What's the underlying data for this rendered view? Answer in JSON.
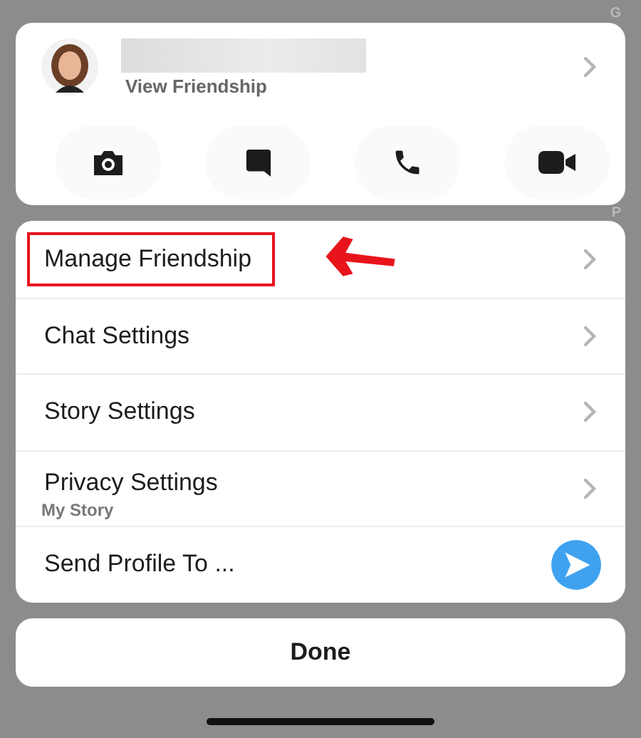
{
  "side_index": [
    "G",
    "P"
  ],
  "profile": {
    "subtitle": "View Friendship",
    "name_redacted": true
  },
  "actions": [
    {
      "kind": "camera"
    },
    {
      "kind": "chat"
    },
    {
      "kind": "call"
    },
    {
      "kind": "video"
    }
  ],
  "menu": [
    {
      "label": "Manage Friendship",
      "kind": "chevron",
      "highlighted": true
    },
    {
      "label": "Chat Settings",
      "kind": "chevron",
      "highlighted": false
    },
    {
      "label": "Story Settings",
      "kind": "chevron",
      "highlighted": false
    },
    {
      "label": "Privacy Settings",
      "sublabel": "My Story",
      "kind": "chevron",
      "highlighted": false
    },
    {
      "label": "Send Profile To ...",
      "kind": "send",
      "highlighted": false
    }
  ],
  "done_button": "Done"
}
